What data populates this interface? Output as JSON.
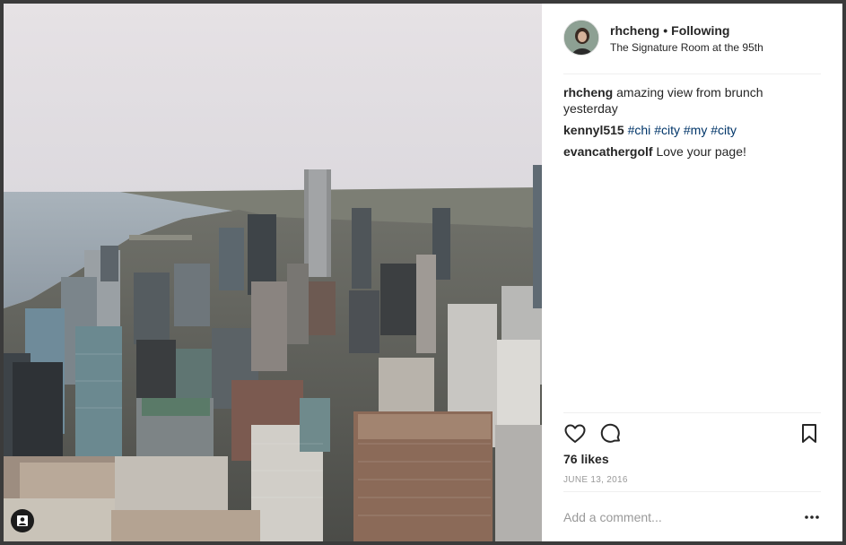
{
  "post": {
    "username": "rhcheng",
    "separator": "•",
    "follow_status": "Following",
    "location": "The Signature Room at the 95th",
    "comments": [
      {
        "author": "rhcheng",
        "text": "amazing view from brunch yesterday",
        "tags": []
      },
      {
        "author": "kennyl515",
        "text": "",
        "tags": [
          "#chi",
          "#city",
          "#my",
          "#city"
        ]
      },
      {
        "author": "evancathergolf",
        "text": "Love your page!",
        "tags": []
      }
    ],
    "likes": "76 likes",
    "date": "JUNE 13, 2016",
    "comment_placeholder": "Add a comment..."
  },
  "icons": {
    "like": "heart-icon",
    "comment": "comment-icon",
    "save": "bookmark-icon",
    "more": "more-options-icon",
    "user_tag": "user-tag-icon"
  },
  "colors": {
    "text": "#262626",
    "hashtag": "#003569",
    "muted": "#999999",
    "divider": "#efefef"
  }
}
